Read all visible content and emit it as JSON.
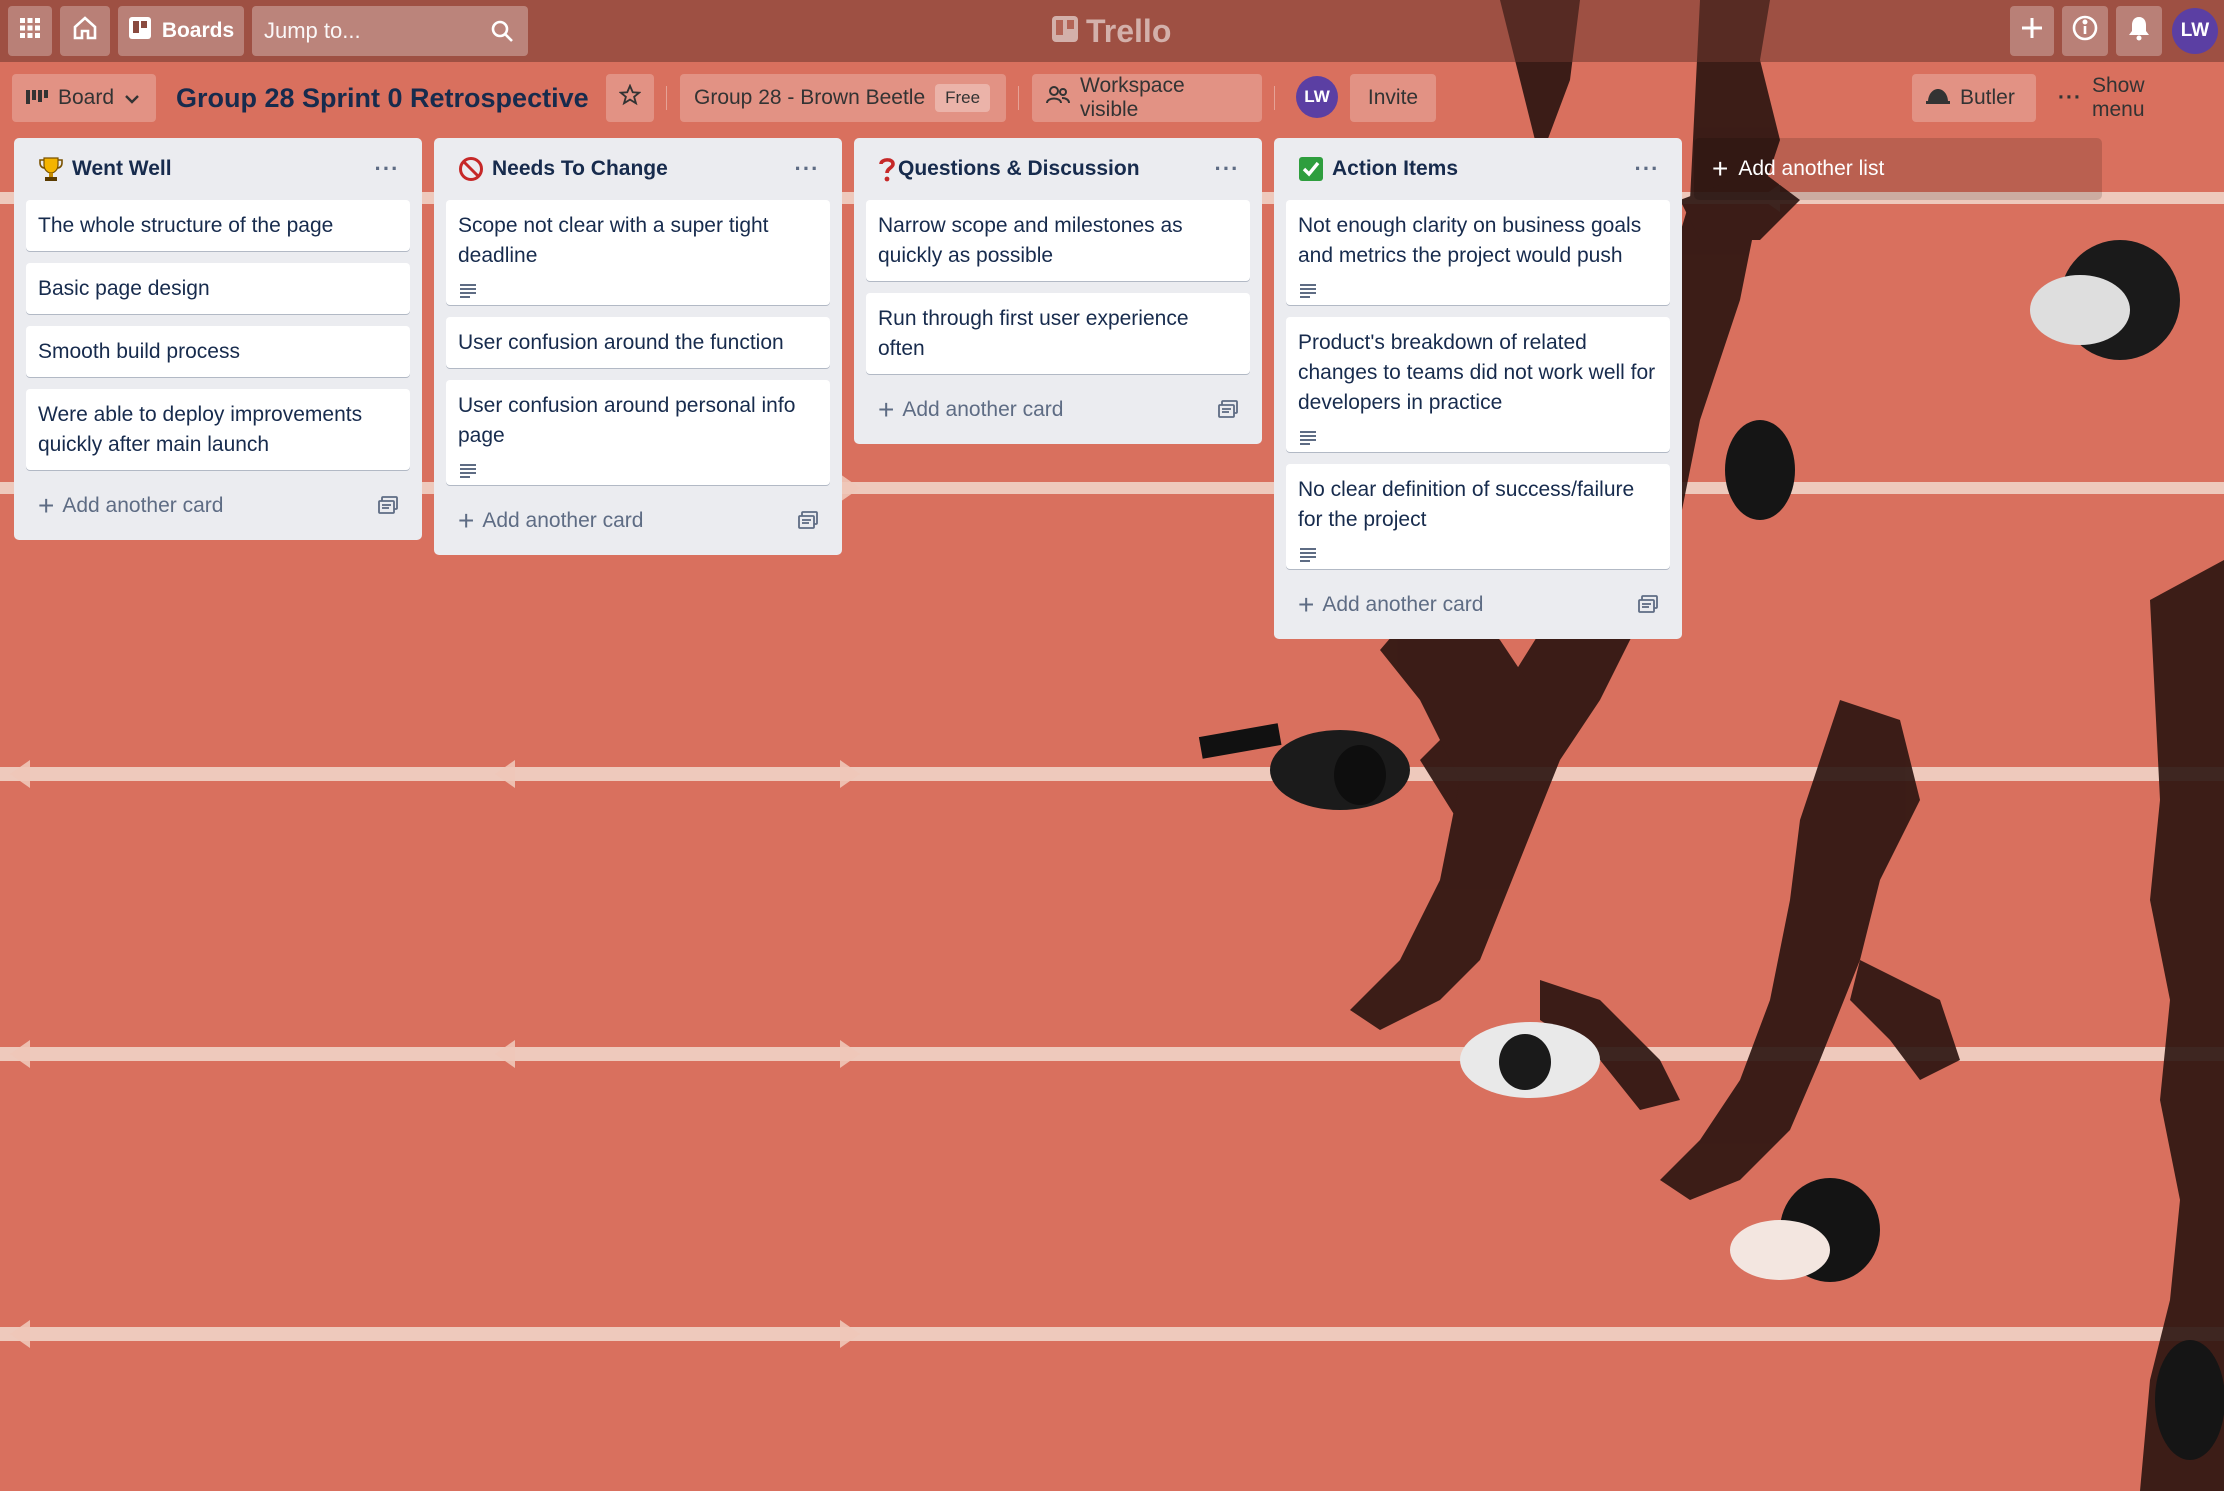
{
  "header": {
    "apps_icon": "grid-icon",
    "home_icon": "home-icon",
    "boards_label": "Boards",
    "search_placeholder": "Jump to...",
    "logo_text": "Trello",
    "create_icon": "plus-icon",
    "info_icon": "info-icon",
    "notifications_icon": "bell-icon",
    "avatar_initials": "LW"
  },
  "board_header": {
    "view_label": "Board",
    "title": "Group 28 Sprint 0 Retrospective",
    "workspace_name": "Group 28 - Brown Beetle",
    "plan_badge": "Free",
    "visibility_label": "Workspace visible",
    "member_initials": "LW",
    "invite_label": "Invite",
    "butler_label": "Butler",
    "show_menu_label": "Show menu"
  },
  "lists": [
    {
      "title": "Went Well",
      "icon": "trophy-icon",
      "cards": [
        {
          "text": "The whole structure of the page",
          "has_description": false
        },
        {
          "text": "Basic page design",
          "has_description": false
        },
        {
          "text": "Smooth build process",
          "has_description": false
        },
        {
          "text": "Were able to deploy improvements quickly after main launch",
          "has_description": false
        }
      ],
      "add_card_label": "Add another card"
    },
    {
      "title": "Needs To Change",
      "icon": "prohibited-icon",
      "cards": [
        {
          "text": "Scope not clear with a super tight deadline",
          "has_description": true
        },
        {
          "text": "User confusion around the function",
          "has_description": false
        },
        {
          "text": "User confusion around personal info page",
          "has_description": true
        }
      ],
      "add_card_label": "Add another card"
    },
    {
      "title": "Questions & Discussion",
      "icon": "question-mark-icon",
      "cards": [
        {
          "text": "Narrow scope and milestones as quickly as possible",
          "has_description": false
        },
        {
          "text": "Run through first user experience often",
          "has_description": false
        }
      ],
      "add_card_label": "Add another card"
    },
    {
      "title": "Action Items",
      "icon": "check-mark-icon",
      "cards": [
        {
          "text": "Not enough clarity on business goals and metrics the project would push",
          "has_description": true
        },
        {
          "text": "Product's breakdown of related changes to teams did not work well for developers in practice",
          "has_description": true
        },
        {
          "text": "No clear definition of success/failure for the project",
          "has_description": true
        }
      ],
      "add_card_label": "Add another card"
    }
  ],
  "add_list_label": "Add another list",
  "colors": {
    "background": "#d9705e",
    "list_bg": "#ebecf0",
    "title_text": "#172b4d",
    "avatar": "#5b3fa3"
  }
}
